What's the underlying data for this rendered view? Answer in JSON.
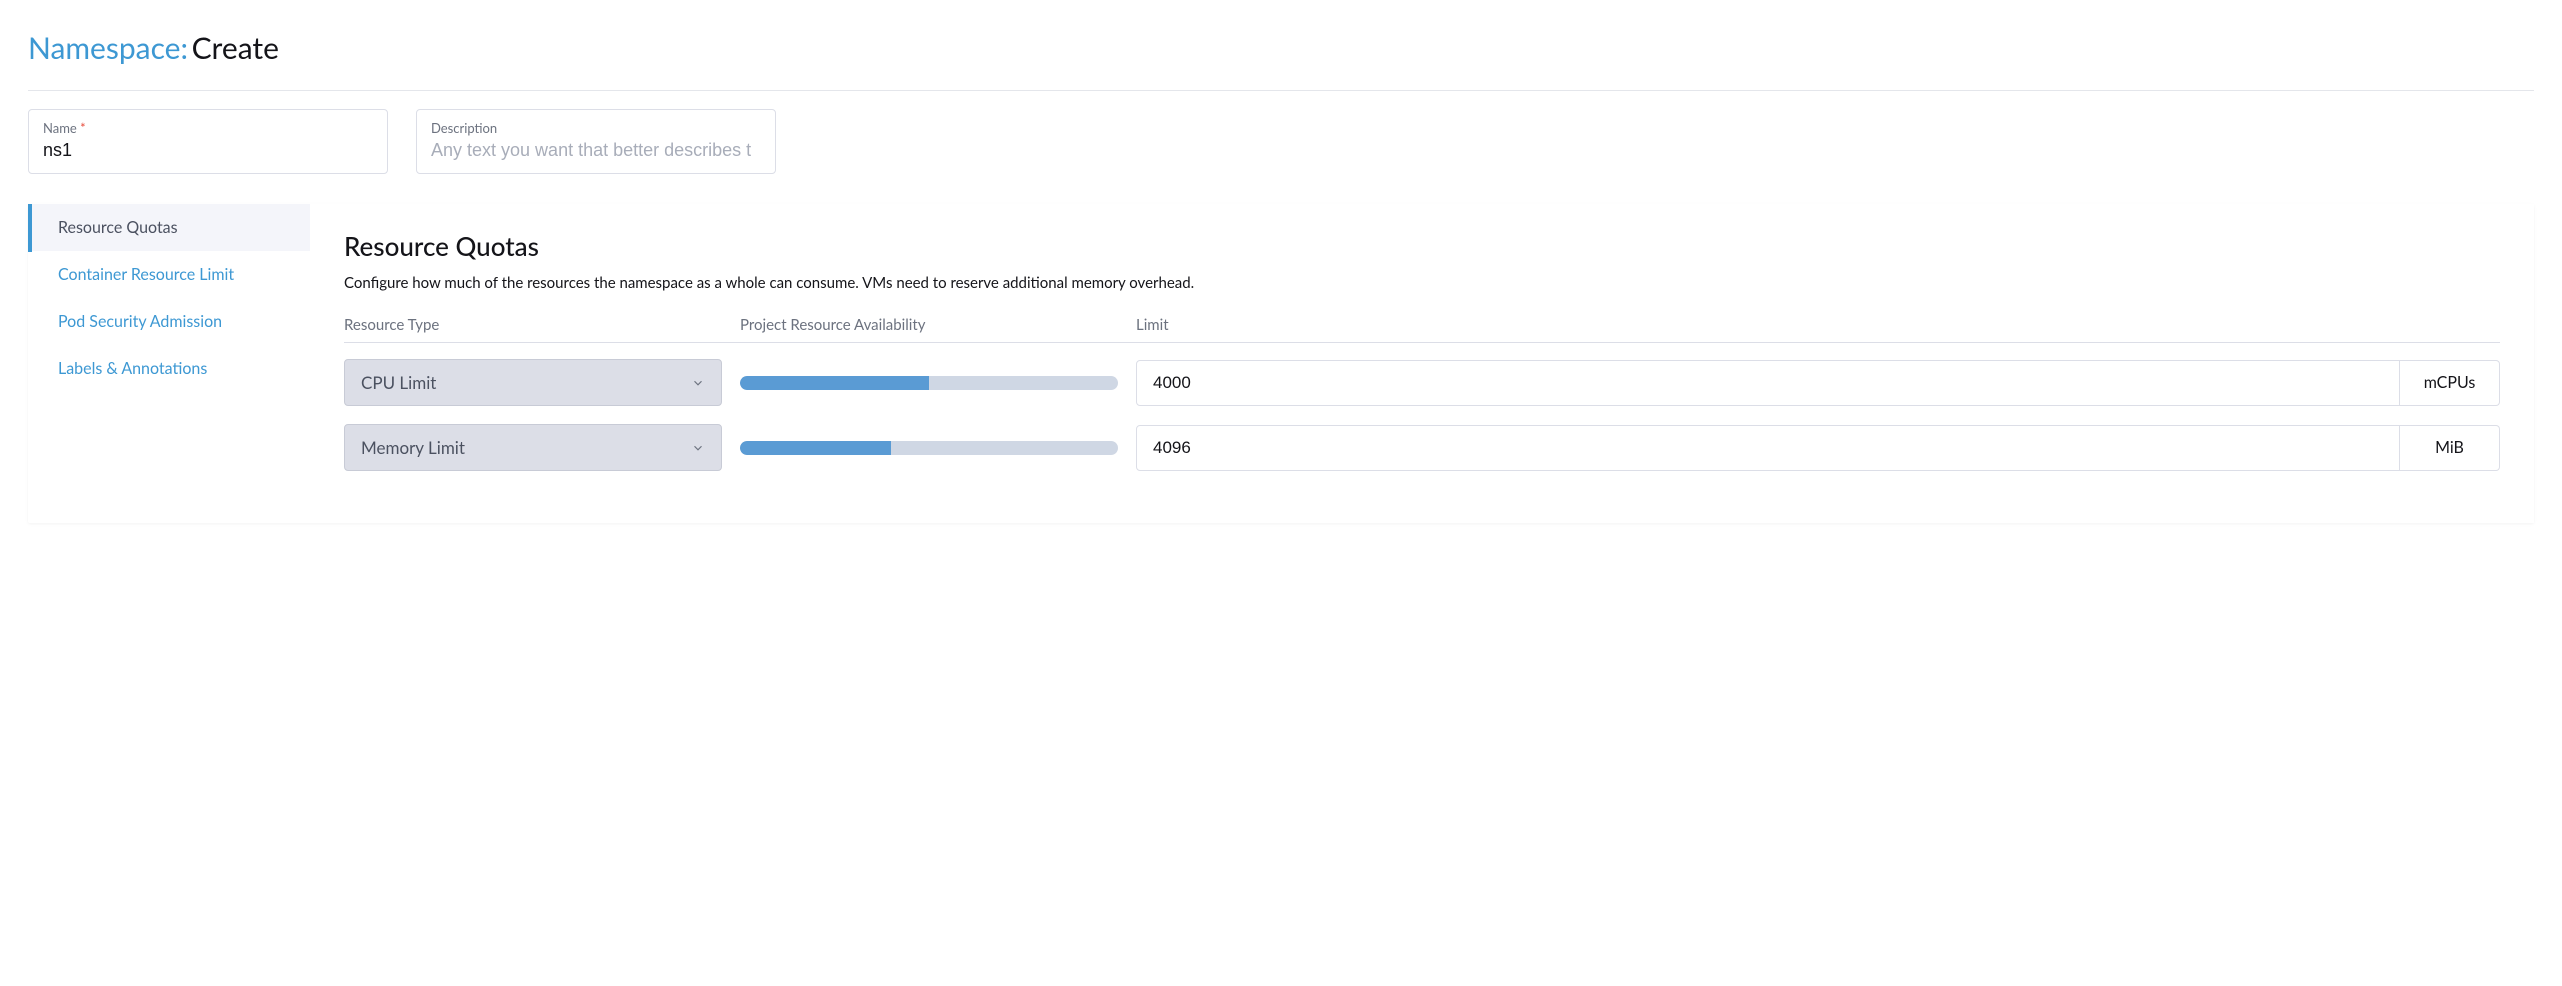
{
  "header": {
    "entity": "Namespace:",
    "action": "Create"
  },
  "form": {
    "name_label": "Name",
    "name_value": "ns1",
    "desc_label": "Description",
    "desc_placeholder": "Any text you want that better describes t"
  },
  "nav": {
    "items": [
      {
        "label": "Resource Quotas",
        "active": true
      },
      {
        "label": "Container Resource Limit",
        "active": false
      },
      {
        "label": "Pod Security Admission",
        "active": false
      },
      {
        "label": "Labels & Annotations",
        "active": false
      }
    ]
  },
  "quotas": {
    "title": "Resource Quotas",
    "description": "Configure how much of the resources the namespace as a whole can consume. VMs need to reserve additional memory overhead.",
    "columns": {
      "type": "Resource Type",
      "avail": "Project Resource Availability",
      "limit": "Limit"
    },
    "rows": [
      {
        "type": "CPU Limit",
        "progress": 50,
        "limit": "4000",
        "unit": "mCPUs"
      },
      {
        "type": "Memory Limit",
        "progress": 40,
        "limit": "4096",
        "unit": "MiB"
      }
    ]
  }
}
